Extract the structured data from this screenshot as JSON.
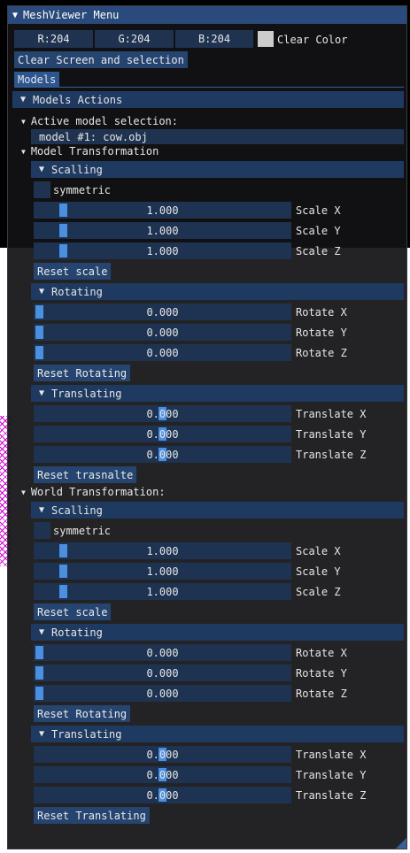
{
  "window": {
    "title": "MeshViewer Menu"
  },
  "clear_color": {
    "r": "R:204",
    "g": "G:204",
    "b": "B:204",
    "label": "Clear Color",
    "swatch": "#cccccc"
  },
  "buttons": {
    "clear_screen": "Clear Screen and selection"
  },
  "tabs": {
    "models": "Models"
  },
  "models_actions": {
    "header": "Models Actions",
    "active_selection": {
      "label": "Active model selection:",
      "value": "model #1: cow.obj"
    }
  },
  "model_transformation": {
    "label": "Model Transformation",
    "scaling": {
      "header": "Scalling",
      "symmetric_label": "symmetric",
      "sliders": [
        {
          "value": "1.000",
          "label": "Scale X"
        },
        {
          "value": "1.000",
          "label": "Scale Y"
        },
        {
          "value": "1.000",
          "label": "Scale Z"
        }
      ],
      "reset": "Reset scale"
    },
    "rotating": {
      "header": "Rotating",
      "sliders": [
        {
          "value": "0.000",
          "label": "Rotate X"
        },
        {
          "value": "0.000",
          "label": "Rotate Y"
        },
        {
          "value": "0.000",
          "label": "Rotate Z"
        }
      ],
      "reset": "Reset Rotating"
    },
    "translating": {
      "header": "Translating",
      "sliders": [
        {
          "value": "0.000",
          "label": "Translate X"
        },
        {
          "value": "0.000",
          "label": "Translate Y"
        },
        {
          "value": "0.000",
          "label": "Translate Z"
        }
      ],
      "reset": "Reset trasnalte"
    }
  },
  "world_transformation": {
    "label": "World Transformation:",
    "scaling": {
      "header": "Scalling",
      "symmetric_label": "symmetric",
      "sliders": [
        {
          "value": "1.000",
          "label": "Scale X"
        },
        {
          "value": "1.000",
          "label": "Scale Y"
        },
        {
          "value": "1.000",
          "label": "Scale Z"
        }
      ],
      "reset": "Reset scale"
    },
    "rotating": {
      "header": "Rotating",
      "sliders": [
        {
          "value": "0.000",
          "label": "Rotate X"
        },
        {
          "value": "0.000",
          "label": "Rotate Y"
        },
        {
          "value": "0.000",
          "label": "Rotate Z"
        }
      ],
      "reset": "Reset Rotating"
    },
    "translating": {
      "header": "Translating",
      "sliders": [
        {
          "value": "0.000",
          "label": "Translate X"
        },
        {
          "value": "0.000",
          "label": "Translate Y"
        },
        {
          "value": "0.000",
          "label": "Translate Z"
        }
      ],
      "reset": "Reset Translating"
    }
  },
  "icons": {
    "collapse_arrow": "triangle-down-icon"
  },
  "colors": {
    "title_bar": "#294a7a",
    "header": "#1f3a61",
    "frame": "#1f3350",
    "slider_grab": "#4a8fe0",
    "button": "#25446f"
  }
}
